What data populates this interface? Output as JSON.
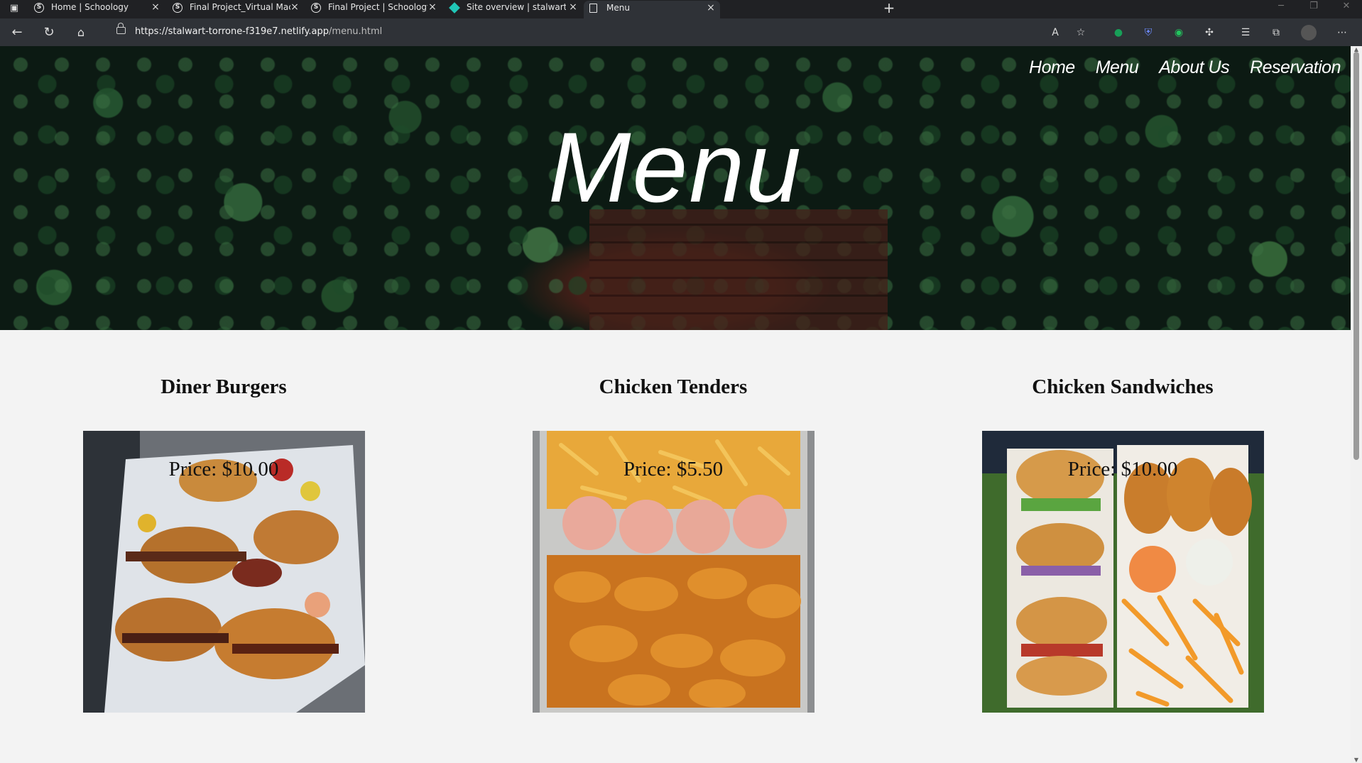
{
  "browser": {
    "tabs": [
      {
        "title": "Home | Schoology",
        "icon": "schoology-icon"
      },
      {
        "title": "Final Project_Virtual Machine | Sc",
        "icon": "schoology-icon"
      },
      {
        "title": "Final Project | Schoology",
        "icon": "schoology-icon"
      },
      {
        "title": "Site overview | stalwart-torrone-",
        "icon": "netlify-icon"
      },
      {
        "title": "Menu",
        "icon": "page-icon"
      }
    ],
    "url_host": "https://stalwart-torrone-f319e7.netlify.app",
    "url_path": "/menu.html"
  },
  "nav": {
    "home": "Home",
    "menu": "Menu",
    "about": "About Us",
    "reservation": "Reservation"
  },
  "hero": {
    "title": "Menu"
  },
  "menu": {
    "items": [
      {
        "name": "Diner Burgers",
        "price": "Price: $10.00"
      },
      {
        "name": "Chicken Tenders",
        "price": "Price: $5.50"
      },
      {
        "name": "Chicken Sandwiches",
        "price": "Price: $10.00"
      }
    ]
  }
}
